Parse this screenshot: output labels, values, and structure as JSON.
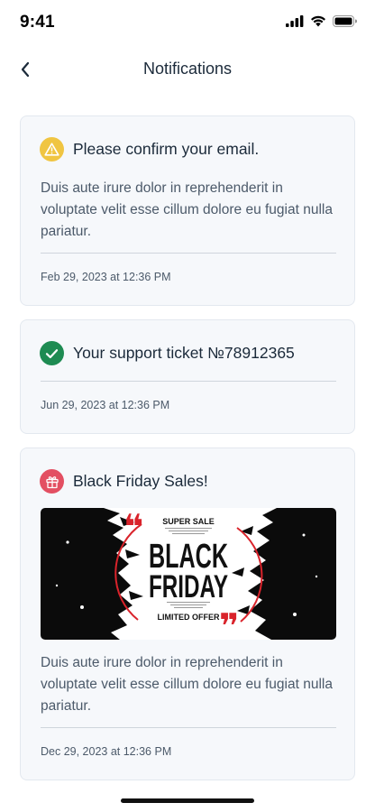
{
  "status_bar": {
    "time": "9:41"
  },
  "header": {
    "title": "Notifications"
  },
  "notifications": [
    {
      "icon": "warning-icon",
      "title": "Please confirm your email.",
      "body": "Duis aute irure dolor in reprehenderit in voluptate velit esse cillum dolore eu fugiat nulla pariatur.",
      "time": "Feb 29, 2023 at 12:36 PM"
    },
    {
      "icon": "check-circle-icon",
      "title": "Your support ticket №78912365",
      "time": "Jun 29, 2023 at 12:36 PM"
    },
    {
      "icon": "gift-icon",
      "title": "Black Friday Sales!",
      "banner": {
        "top_line": "SUPER SALE",
        "line1": "BLACK",
        "line2": "FRIDAY",
        "bottom_line": "LIMITED OFFER"
      },
      "body": "Duis aute irure dolor in reprehenderit in voluptate velit esse cillum dolore eu fugiat nulla pariatur.",
      "time": "Dec 29, 2023 at 12:36 PM"
    }
  ],
  "colors": {
    "warning": "#f0c542",
    "success": "#1e8b52",
    "promo": "#e34f62",
    "card_bg": "#f6f8fb",
    "banner_accent": "#d9232b"
  }
}
